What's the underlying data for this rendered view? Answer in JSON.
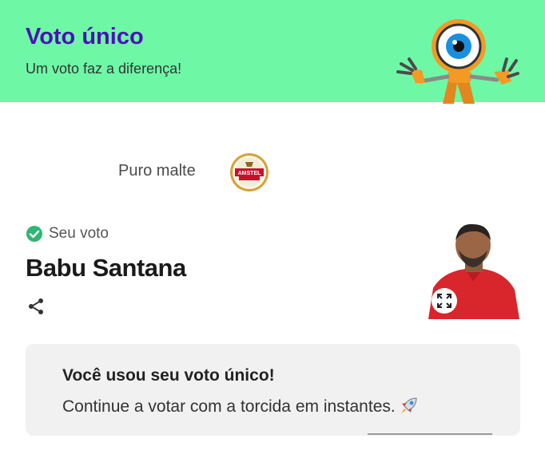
{
  "header": {
    "title": "Voto único",
    "subtitle": "Um voto faz a diferença!",
    "mascot_icon": "big-brother-eye-mascot",
    "background": "#6ef8a6",
    "title_color": "#4b12b8"
  },
  "sponsor": {
    "text": "Puro malte",
    "logo_icon": "amstel-lager-logo"
  },
  "vote": {
    "status_label": "Seu voto",
    "status_icon": "check-circle-icon",
    "candidate_name": "Babu Santana",
    "share_icon": "share-icon",
    "expand_icon": "expand-icon"
  },
  "message": {
    "title": "Você usou seu voto único!",
    "body": "Continue a votar com a torcida em instantes.",
    "emoji_icon": "rocket-icon"
  }
}
